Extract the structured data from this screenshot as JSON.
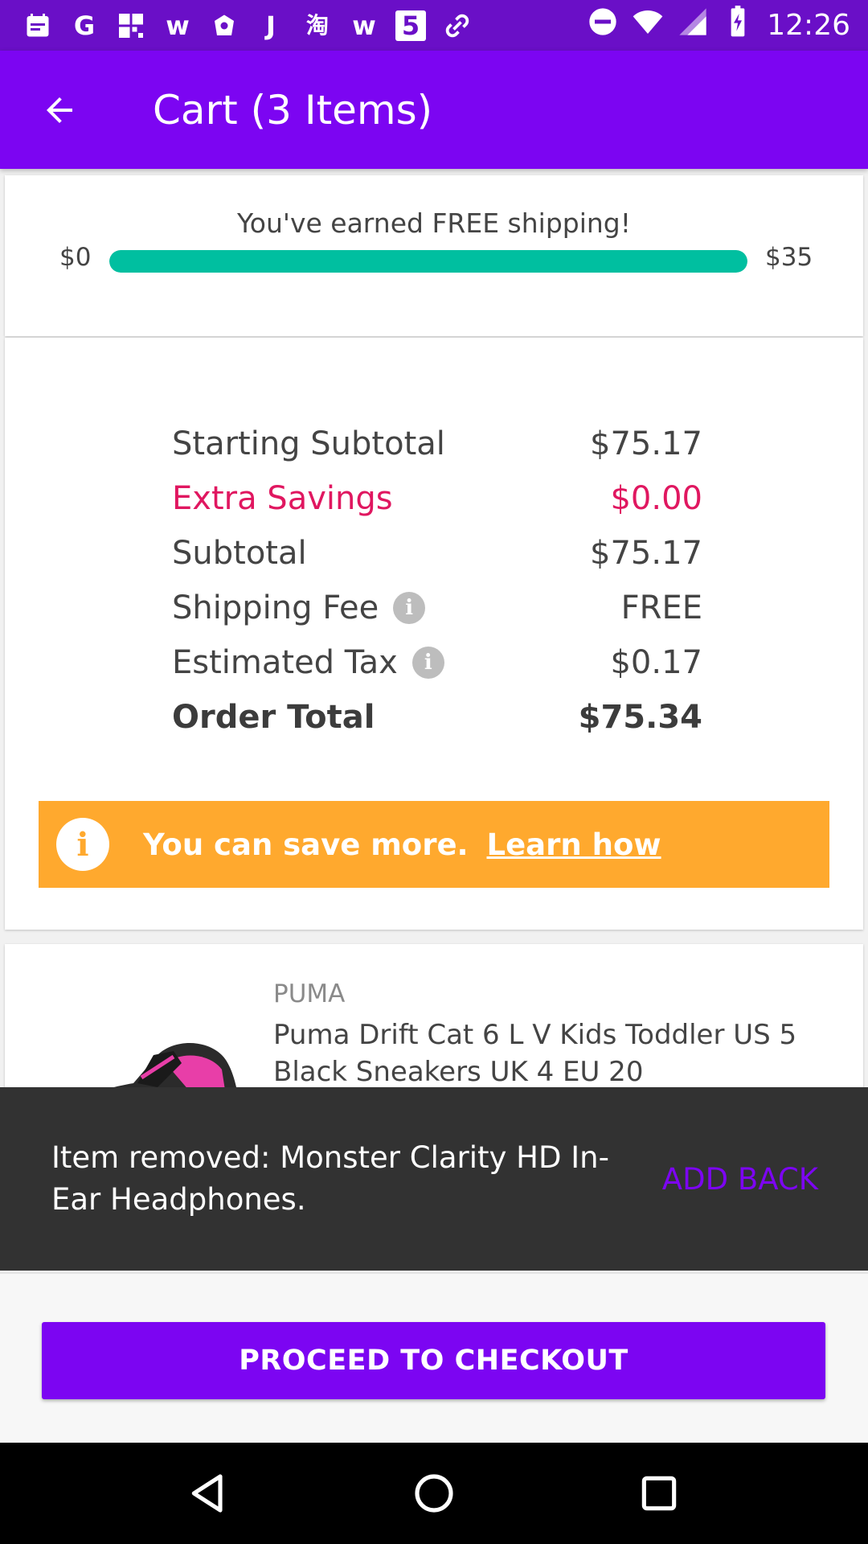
{
  "status_bar": {
    "time": "12:26",
    "notification_icons": [
      "calendar-icon",
      "google-icon",
      "grid-app-icon",
      "walmart-w-icon",
      "shopping-bag-icon",
      "j-app-icon",
      "taobao-icon",
      "walmart-w-icon",
      "html5-icon",
      "link-app-icon"
    ],
    "notification_glyphs": [
      "",
      "G",
      "",
      "w",
      "",
      "J",
      "淘",
      "w",
      "5",
      ""
    ],
    "system_icons": [
      "do-not-disturb-icon",
      "wifi-icon",
      "signal-icon",
      "battery-icon"
    ]
  },
  "app_bar": {
    "title": "Cart (3 Items)",
    "back_icon": "arrow-left-icon"
  },
  "shipping": {
    "message": "You've earned FREE shipping!",
    "min_label": "$0",
    "max_label": "$35",
    "progress_fraction": 1.0,
    "progress_color": "#00bfa0"
  },
  "summary": {
    "rows": [
      {
        "label": "Starting Subtotal",
        "value": "$75.17"
      },
      {
        "label": "Extra Savings",
        "value": "$0.00"
      },
      {
        "label": "Subtotal",
        "value": "$75.17"
      },
      {
        "label": "Shipping Fee",
        "value": "FREE"
      },
      {
        "label": "Estimated Tax",
        "value": "$0.17"
      },
      {
        "label": "Order Total",
        "value": "$75.34"
      }
    ],
    "info_glyph": "i",
    "savings_color": "#e01760"
  },
  "save_banner": {
    "icon_glyph": "i",
    "text": "You can save more.",
    "link": "Learn how",
    "color": "#ffa92e"
  },
  "cart_item": {
    "brand": "PUMA",
    "name": "Puma Drift Cat 6 L V Kids Toddler US 5 Black Sneakers UK 4 EU 20"
  },
  "snackbar": {
    "message": "Item removed: Monster Clarity HD In-Ear Headphones.",
    "action": "ADD BACK"
  },
  "checkout": {
    "button_label": "PROCEED TO CHECKOUT"
  },
  "colors": {
    "accent": "#7c05f2",
    "status_bar": "#6a0fc7"
  }
}
